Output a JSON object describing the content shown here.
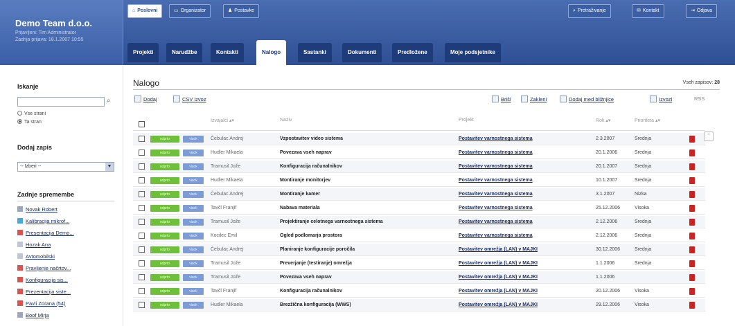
{
  "brand": {
    "title": "Demo Team d.o.o.",
    "user_line": "Prijavljeni: Tim Administrator",
    "date_line": "Zadnja prijava: 18.1.2007 10:55"
  },
  "top_buttons": {
    "left": [
      {
        "icon": "home-icon",
        "glyph": "⌂",
        "label": "Poslovni",
        "active": true
      },
      {
        "icon": "briefcase-icon",
        "glyph": "▭",
        "label": "Organizator",
        "active": false
      },
      {
        "icon": "person-icon",
        "glyph": "♟",
        "label": "Postavke",
        "active": false
      }
    ],
    "right": [
      {
        "icon": "search-icon",
        "glyph": "⌕",
        "label": "Pretraživanje"
      },
      {
        "icon": "mail-icon",
        "glyph": "✉",
        "label": "Kontakt"
      },
      {
        "icon": "logout-icon",
        "glyph": "⇥",
        "label": "Odjava"
      }
    ]
  },
  "nav_tabs": [
    {
      "label": "Projekti",
      "active": false
    },
    {
      "label": "Narudžbe",
      "active": false
    },
    {
      "label": "Kontakti",
      "active": false
    },
    {
      "label": "Nalogo",
      "active": true
    },
    {
      "label": "Sastanki",
      "active": false
    },
    {
      "label": "Dokumenti",
      "active": false
    },
    {
      "label": "Predložene",
      "active": false
    },
    {
      "label": "Moje podsjetnike",
      "active": false
    }
  ],
  "sidebar": {
    "search_heading": "Iskanje",
    "search_value": "",
    "radios": [
      {
        "label": "Vse strani",
        "checked": false
      },
      {
        "label": "Ta stran",
        "checked": true
      }
    ],
    "add_heading": "Dodaj zapis",
    "add_select": "-- Izberi --",
    "recent_heading": "Zadnje spremembe",
    "recent": [
      {
        "label": "Novak Robert",
        "color": "#9aa7bf"
      },
      {
        "label": "Kalibracija mikrof...",
        "color": "#4aa8d8"
      },
      {
        "label": "Presentacija Demo...",
        "color": "#d9534f"
      },
      {
        "label": "Hozak Ana",
        "color": "#bfc6d4"
      },
      {
        "label": "Avtomobilski",
        "color": "#bfc6d4"
      },
      {
        "label": "Pravljenje načrtov...",
        "color": "#d9534f"
      },
      {
        "label": "Konfiguracija sis...",
        "color": "#d9534f"
      },
      {
        "label": "Prezentacija siste...",
        "color": "#d9534f"
      },
      {
        "label": "Pavli Zorana (54)",
        "color": "#d9534f"
      },
      {
        "label": "Boof Mirja",
        "color": "#9aa7bf"
      }
    ]
  },
  "main": {
    "title": "Nalogo",
    "record_label": "Vseh zapisov:",
    "record_count": "28",
    "toolbar_left": [
      {
        "icon": "document-icon",
        "label": "Dodaj"
      },
      {
        "icon": "csv-icon",
        "label": "CSV izvoz"
      }
    ],
    "toolbar_right": [
      {
        "icon": "delete-icon",
        "label": "Briši"
      },
      {
        "icon": "print-icon",
        "label": "Zakleni"
      },
      {
        "icon": "search-icon",
        "label": "Dodaj med bližnjice"
      },
      {
        "icon": "export-icon",
        "label": "Izvozi"
      },
      {
        "icon": "rss-icon",
        "label": "RSS"
      }
    ],
    "columns": [
      "Izvajalci",
      "Naziv",
      "Projekt",
      "Rok",
      "Prioriteta"
    ],
    "status_label": "odprto",
    "priority_label": "visok",
    "rows": [
      {
        "user": "Čebulac Andrej",
        "name": "Vzpostavitev video sistema",
        "project": "Postavitev varnostnega sistema",
        "date": "2.3.2007",
        "prio": "Srednja"
      },
      {
        "user": "Hudler Mikaela",
        "name": "Povezava vseh naprav",
        "project": "Postavitev varnostnega sistema",
        "date": "20.1.2006",
        "prio": "Srednja"
      },
      {
        "user": "Tramusil Jože",
        "name": "Konfiguracija računalnikov",
        "project": "Postavitev varnostnega sistema",
        "date": "20.1.2007",
        "prio": "Srednja"
      },
      {
        "user": "Hudler Mikaela",
        "name": "Montiranje monitorjev",
        "project": "Postavitev varnostnega sistema",
        "date": "10.1.2007",
        "prio": "Srednja"
      },
      {
        "user": "Čebulac Andrej",
        "name": "Montiranje kamer",
        "project": "Postavitev varnostnega sistema",
        "date": "3.1.2007",
        "prio": "Nizka"
      },
      {
        "user": "Tavčl Franjif",
        "name": "Nabava materiala",
        "project": "Postavitev varnostnega sistema",
        "date": "25.12.2006",
        "prio": "Visoka"
      },
      {
        "user": "Tramusil Jože",
        "name": "Projektiranje celotnega varnostnega sistema",
        "project": "Postavitev varnostnega sistema",
        "date": "2.12.2006",
        "prio": "Srednja"
      },
      {
        "user": "Kocilec Emil",
        "name": "Ogled podlomarja prostora",
        "project": "Postavitev varnostnega sistema",
        "date": "2.12.2006",
        "prio": "Srednja"
      },
      {
        "user": "Čebulac Andrej",
        "name": "Planiranje konfiguracije poročila",
        "project": "Postavitev omrežja (LAN) v MAJKI",
        "date": "30.12.2006",
        "prio": "Srednja"
      },
      {
        "user": "Tramusil Jože",
        "name": "Preverjanje (testiranje) omrežja",
        "project": "Postavitev omrežja (LAN) v MAJKI",
        "date": "1.1.2006",
        "prio": "Srednja"
      },
      {
        "user": "Tramusil Jože",
        "name": "Povezava vseh naprav",
        "project": "Postavitev omrežja (LAN) v MAJKI",
        "date": "1.1.2006",
        "prio": ""
      },
      {
        "user": "Tavčl Franjif",
        "name": "Konfiguracija računalnikov",
        "project": "Postavitev omrežja (LAN) v MAJKI",
        "date": "20.12.2006",
        "prio": "Visoka"
      },
      {
        "user": "Hudler Mikaela",
        "name": "Brezžična konfiguracija (WWS)",
        "project": "Postavitev omrežja (LAN) v MAJKI",
        "date": "29.12.2006",
        "prio": "Visoka"
      }
    ]
  },
  "colors": {
    "header": "#2e4f94",
    "tab_dark": "#1f3c7a",
    "status_green": "#6fbf3c",
    "priority_blue": "#7d9cd6",
    "delete_red": "#cc2222"
  }
}
